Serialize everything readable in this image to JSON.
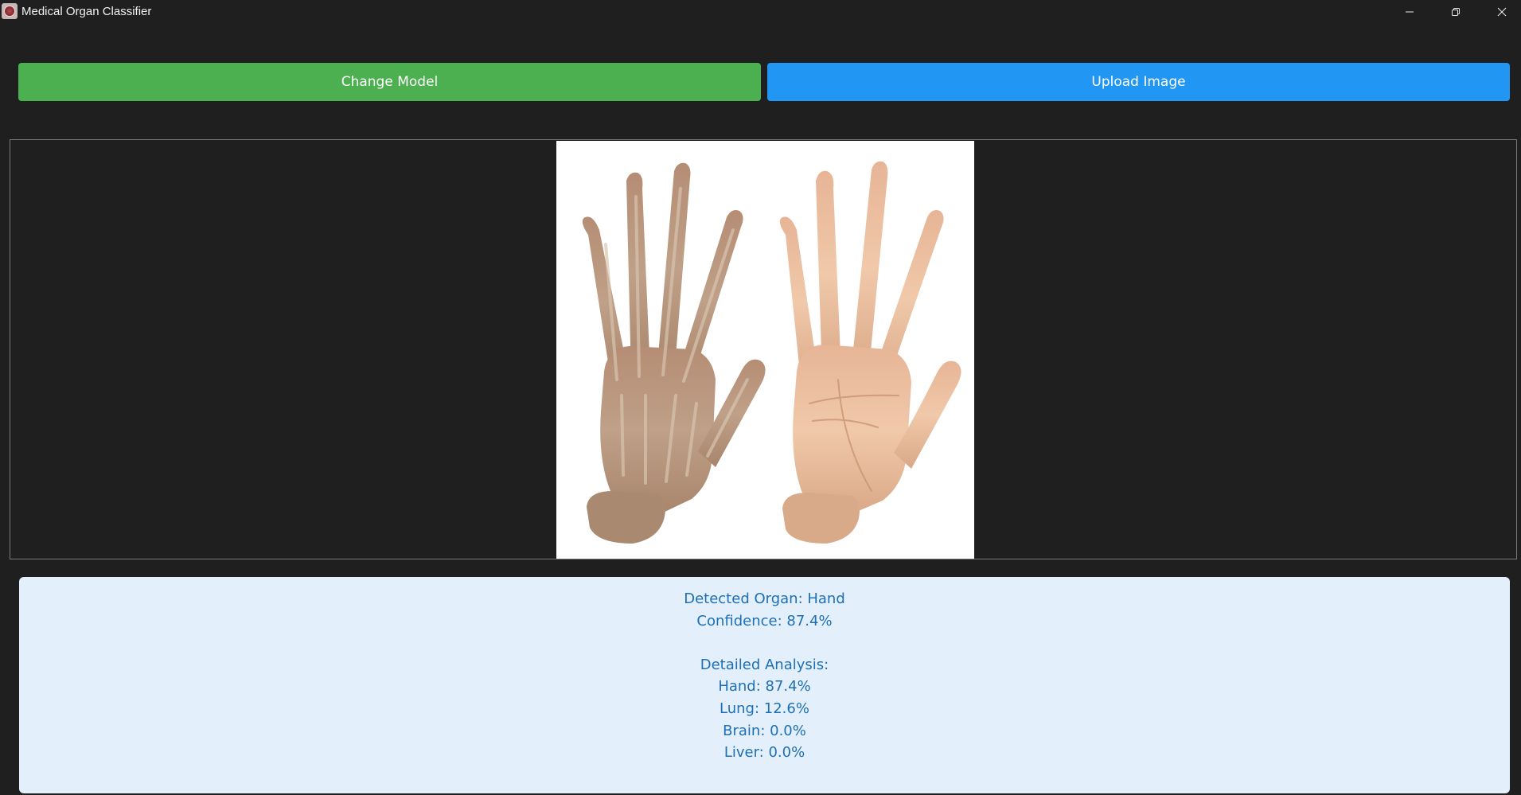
{
  "window": {
    "title": "Medical Organ Classifier",
    "app_icon": "medical-app-icon",
    "controls": {
      "minimize_icon": "minimize-icon",
      "maximize_icon": "restore-icon",
      "close_icon": "close-icon"
    }
  },
  "toolbar": {
    "change_model_label": "Change Model",
    "upload_image_label": "Upload Image",
    "change_model_color": "#4caf50",
    "upload_image_color": "#2196f3"
  },
  "preview": {
    "image_subject": "two-hands-back-and-palm"
  },
  "results": {
    "detected_organ": "Detected Organ: Hand",
    "confidence": "Confidence: 87.4%",
    "detailed_heading": "Detailed Analysis:",
    "breakdown": [
      "Hand: 87.4%",
      "Lung: 12.6%",
      "Brain: 0.0%",
      "Liver: 0.0%"
    ],
    "text_color": "#1e6fb5",
    "background_color": "#e3f0fb"
  }
}
